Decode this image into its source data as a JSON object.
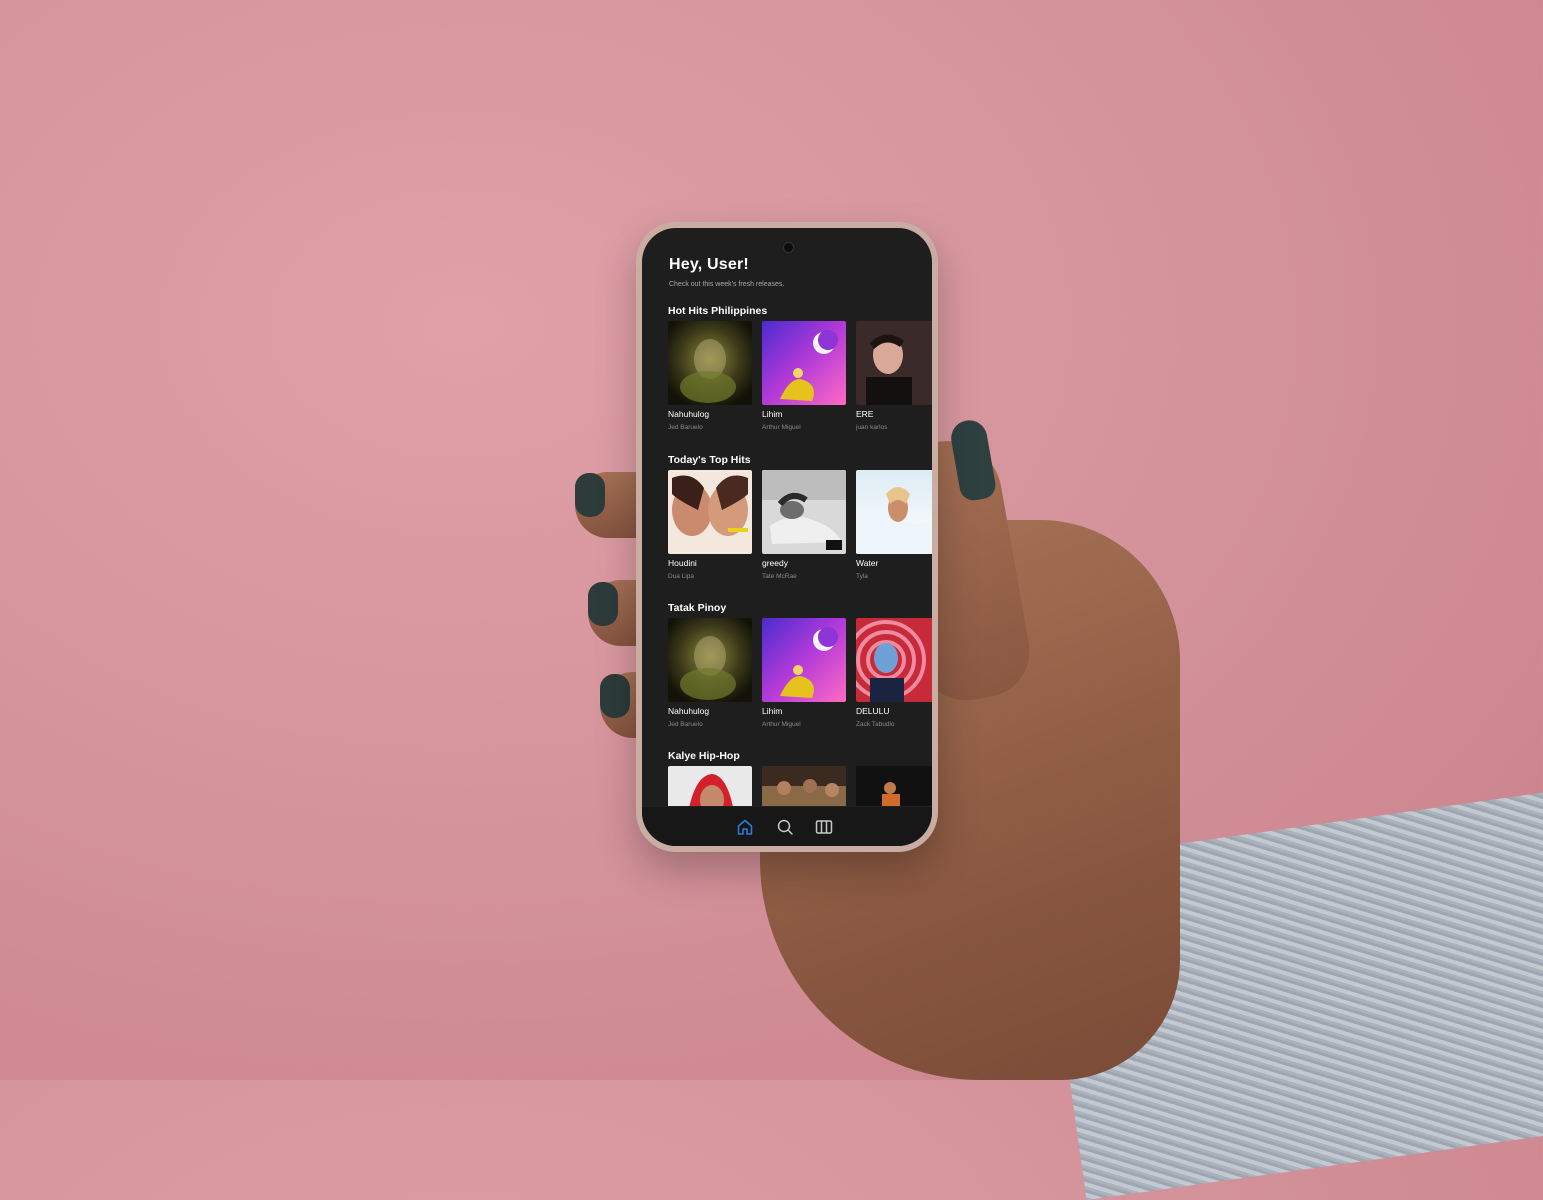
{
  "app": {
    "greeting": "Hey, User!",
    "subtitle": "Check out this week's fresh releases."
  },
  "sections": [
    {
      "title": "Hot Hits Philippines",
      "items": [
        {
          "title": "Nahuhulog",
          "artist": "Jed Baruelo",
          "cover": "blurred-green-portrait"
        },
        {
          "title": "Lihim",
          "artist": "Arthur Miguel",
          "cover": "purple-moon-art"
        },
        {
          "title": "ERE",
          "artist": "juan karlos",
          "cover": "man-portrait-dark"
        }
      ]
    },
    {
      "title": "Today's Top Hits",
      "items": [
        {
          "title": "Houdini",
          "artist": "Dua Lipa",
          "cover": "two-faces-kiss"
        },
        {
          "title": "greedy",
          "artist": "Tate McRae",
          "cover": "bw-woman-lying"
        },
        {
          "title": "Water",
          "artist": "Tyla",
          "cover": "woman-in-water"
        }
      ]
    },
    {
      "title": "Tatak Pinoy",
      "items": [
        {
          "title": "Nahuhulog",
          "artist": "Jed Baruelo",
          "cover": "blurred-green-portrait"
        },
        {
          "title": "Lihim",
          "artist": "Arthur Miguel",
          "cover": "purple-moon-art"
        },
        {
          "title": "DELULU",
          "artist": "Zack Tabudlo",
          "cover": "red-spiral-portrait"
        }
      ]
    },
    {
      "title": "Kalye Hip-Hop",
      "items": [
        {
          "title": "",
          "artist": "",
          "cover": "red-hood-portrait"
        },
        {
          "title": "",
          "artist": "",
          "cover": "sofa-group"
        },
        {
          "title": "",
          "artist": "",
          "cover": "dark-figure"
        }
      ]
    }
  ],
  "nav": {
    "items": [
      {
        "icon": "home-icon",
        "active": true
      },
      {
        "icon": "search-icon",
        "active": false
      },
      {
        "icon": "library-icon",
        "active": false
      }
    ],
    "active_color": "#2f7de1",
    "inactive_color": "#c8c8c8"
  },
  "colors": {
    "background": "#d9979f",
    "screen": "#1e1e1f",
    "text_primary": "#ffffff",
    "text_secondary": "#8a8a8a"
  }
}
